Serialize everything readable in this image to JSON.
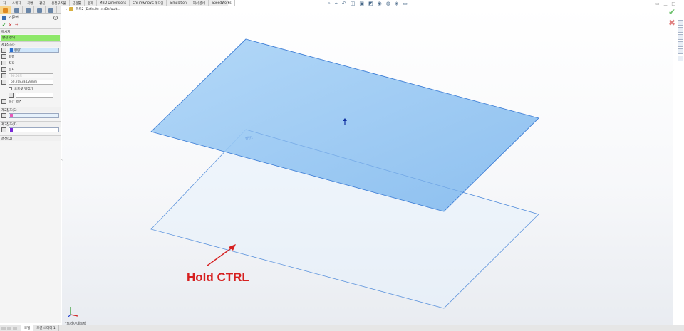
{
  "command_tabs": [
    "처",
    "스케치",
    "곡면",
    "판금",
    "용접구조물",
    "금형툴",
    "평가",
    "MBD Dimensions",
    "SOLIDWORKS 애드인",
    "Simulation",
    "해석 준비",
    "SpeedWorks"
  ],
  "hud_icons": [
    "search-icon",
    "zoom-area-icon",
    "previous-view-icon",
    "section-view-icon",
    "view-orientation-icon",
    "display-style-icon",
    "hide-show-icon",
    "edit-appearance-icon",
    "scene-icon",
    "view-settings-icon"
  ],
  "pm": {
    "title": "기준면",
    "help": "?",
    "ok": "✔",
    "cancel": "✕",
    "pin": "⇔",
    "message_header": "메시지",
    "message_text": "완전 정의",
    "first_ref": {
      "header": "제1참조(F)",
      "value": "평면1",
      "options": [
        "평행",
        "직각",
        "일치"
      ],
      "angle": "90.00도",
      "offset": "60.20833429mm",
      "flip_label": "오프셋 뒤집기",
      "count": "1",
      "mid_plane": "중간 평면"
    },
    "second_ref": {
      "header": "제2참조(S)",
      "value": ""
    },
    "third_ref": {
      "header": "제3참조(T)",
      "value": ""
    },
    "options_header": "옵션(O)"
  },
  "flyout": {
    "arrow": "▸",
    "text": "파트2 (Default) <<Default..."
  },
  "scene": {
    "plane_label": "평면1",
    "annotation": "Hold CTRL"
  },
  "view_label": "*트라이메트릭",
  "bottom_tabs": [
    "모델",
    "모션 스터디 1"
  ],
  "colors": {
    "accent_green": "#8ee86a",
    "plane_fill": "#8fc4f2",
    "annotation_red": "#d62020"
  }
}
